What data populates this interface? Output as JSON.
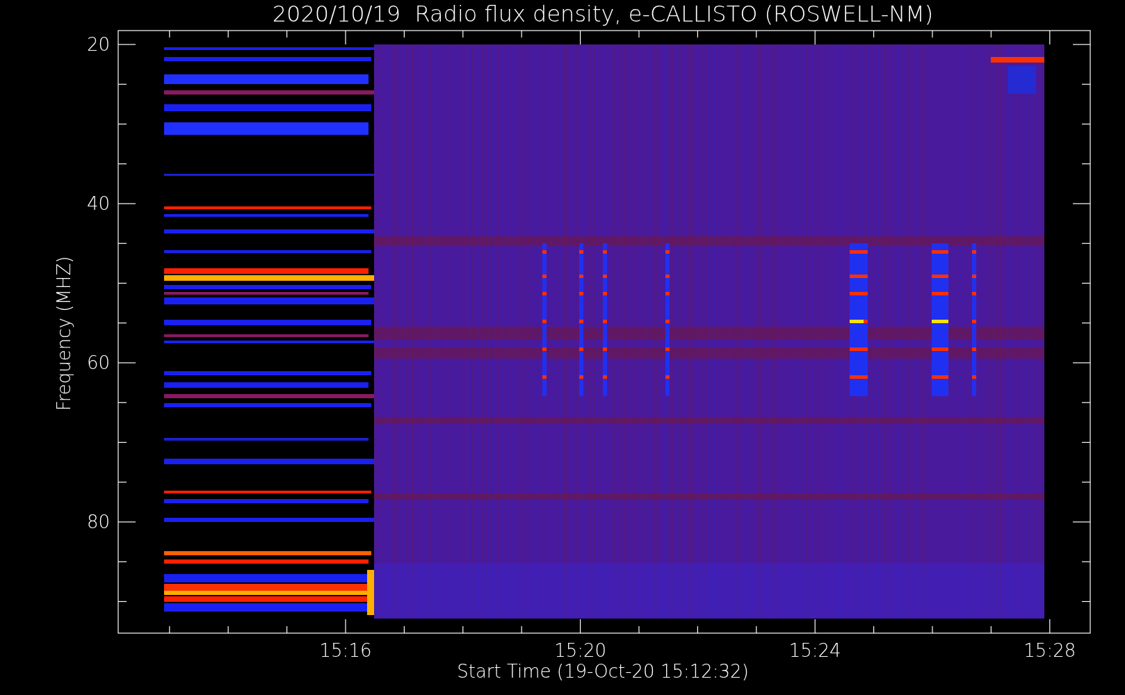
{
  "title": "2020/10/19  Radio flux density, e-CALLISTO (ROSWELL-NM)",
  "y_axis": {
    "label": "Frequency (MHZ)",
    "ticks": [
      "20",
      "40",
      "60",
      "80"
    ]
  },
  "x_axis": {
    "label": "Start Time (19-Oct-20 15:12:32)",
    "ticks": [
      "15:16",
      "15:20",
      "15:24",
      "15:28"
    ]
  }
}
